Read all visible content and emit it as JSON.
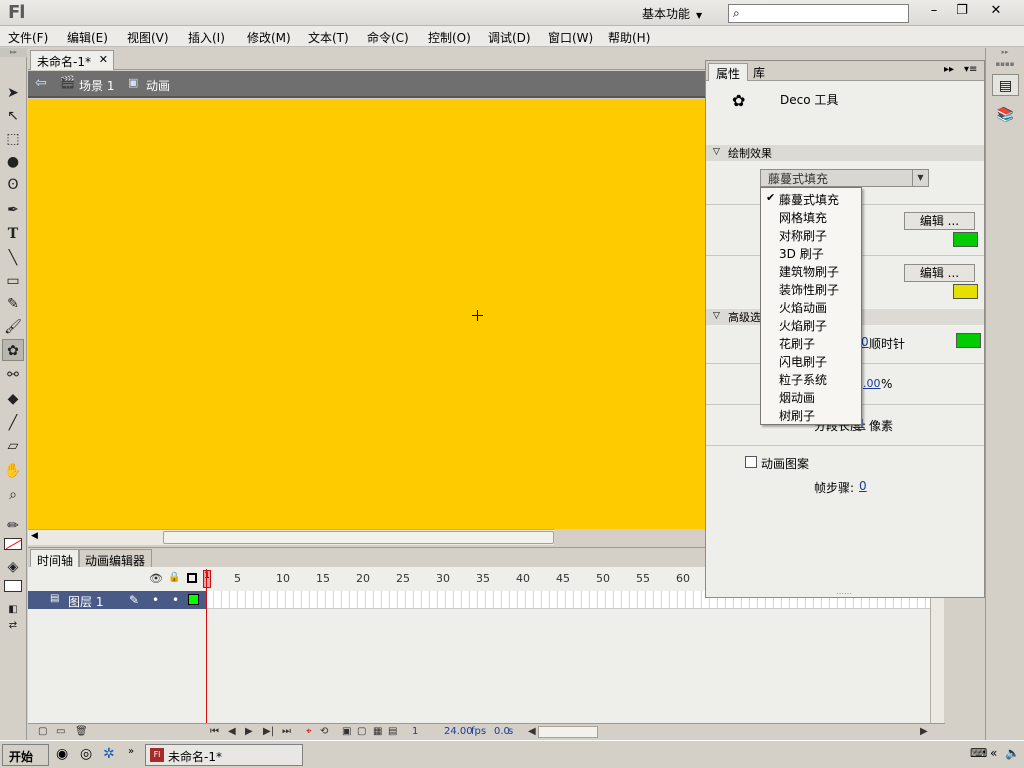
{
  "app": {
    "logo": "Fl",
    "workspace": "基本功能",
    "window_controls": {
      "minimize": "–",
      "restore": "❐",
      "close": "✕"
    }
  },
  "menu": [
    "文件(F)",
    "编辑(E)",
    "视图(V)",
    "插入(I)",
    "修改(M)",
    "文本(T)",
    "命令(C)",
    "控制(O)",
    "调试(D)",
    "窗口(W)",
    "帮助(H)"
  ],
  "document": {
    "tab_title": "未命名-1*"
  },
  "scene": {
    "scene_label": "场景 1",
    "symbol_label": "动画"
  },
  "stage": {
    "background_color": "#FECB00"
  },
  "timeline": {
    "tabs": [
      "时间轴",
      "动画编辑器"
    ],
    "frame_numbers": [
      "1",
      "5",
      "10",
      "15",
      "20",
      "25",
      "30",
      "35",
      "40",
      "45",
      "50",
      "55",
      "60"
    ],
    "layer": {
      "name": "图层 1"
    },
    "status": {
      "current_frame": "1",
      "fps": "24.00",
      "fps_unit": "fps",
      "time": "0.0",
      "time_unit": "s"
    }
  },
  "properties_panel": {
    "tabs": [
      "属性",
      "库"
    ],
    "tool_name": "Deco 工具",
    "section_draw": "绘制效果",
    "effect_selected": "藤蔓式填充",
    "edit_label": "编辑 ...",
    "section_advanced": "高级选",
    "leaf_rotation_suffix": "顺时针",
    "rotation_value": "0",
    "scale_value": ".00",
    "scale_unit": "%",
    "segment_label": "分段长度:",
    "segment_value": "1",
    "segment_unit": "像素",
    "animate_pattern": "动画图案",
    "frame_step_label": "帧步骤:",
    "frame_step_value": "0",
    "swatch_colors": [
      "#00CC00",
      "#E5E000",
      "#00CC00"
    ]
  },
  "effect_dropdown": {
    "selected_index": 0,
    "options": [
      "藤蔓式填充",
      "网格填充",
      "对称刷子",
      "3D 刷子",
      "建筑物刷子",
      "装饰性刷子",
      "火焰动画",
      "火焰刷子",
      "花刷子",
      "闪电刷子",
      "粒子系统",
      "烟动画",
      "树刷子"
    ]
  },
  "taskbar": {
    "start_label": "开始",
    "app_label": "未命名-1*"
  }
}
